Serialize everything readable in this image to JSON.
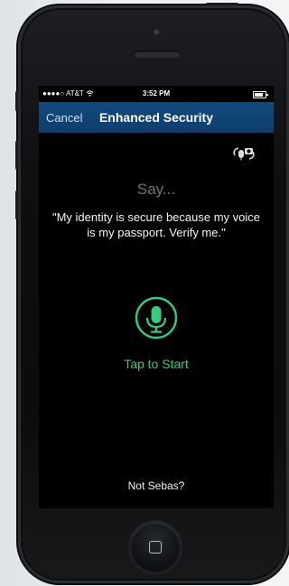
{
  "status_bar": {
    "signal": "●●●●○",
    "carrier": "AT&T",
    "time": "3:52 PM"
  },
  "navbar": {
    "cancel_label": "Cancel",
    "title": "Enhanced Security"
  },
  "content": {
    "prompt": "Say...",
    "passphrase": "\"My identity is secure because my voice is my passport. Verify me.\"",
    "tap_label": "Tap to Start",
    "not_user_label": "Not Sebas?"
  },
  "colors": {
    "nav_background": "#0d3f6f",
    "accent_green": "#37c97f"
  },
  "icons": {
    "swap_mode": "voice-camera-switch-icon",
    "record": "microphone-icon"
  }
}
